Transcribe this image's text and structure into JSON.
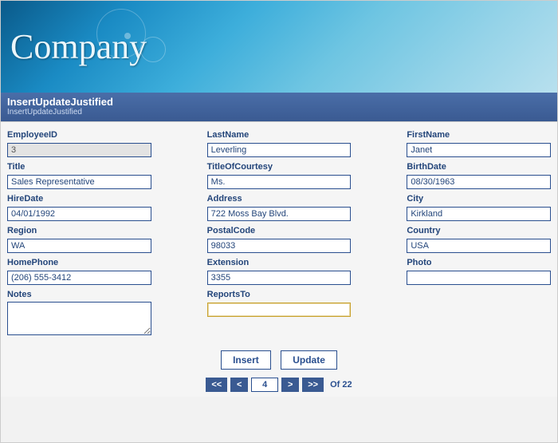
{
  "banner": {
    "title": "Company"
  },
  "subheader": {
    "title": "InsertUpdateJustified",
    "subtitle": "InsertUpdateJustified"
  },
  "fields": {
    "EmployeeID": {
      "label": "EmployeeID",
      "value": "3"
    },
    "LastName": {
      "label": "LastName",
      "value": "Leverling"
    },
    "FirstName": {
      "label": "FirstName",
      "value": "Janet"
    },
    "Title": {
      "label": "Title",
      "value": "Sales Representative"
    },
    "TitleOfCourtesy": {
      "label": "TitleOfCourtesy",
      "value": "Ms."
    },
    "BirthDate": {
      "label": "BirthDate",
      "value": "08/30/1963"
    },
    "HireDate": {
      "label": "HireDate",
      "value": "04/01/1992"
    },
    "Address": {
      "label": "Address",
      "value": "722 Moss Bay Blvd."
    },
    "City": {
      "label": "City",
      "value": "Kirkland"
    },
    "Region": {
      "label": "Region",
      "value": "WA"
    },
    "PostalCode": {
      "label": "PostalCode",
      "value": "98033"
    },
    "Country": {
      "label": "Country",
      "value": "USA"
    },
    "HomePhone": {
      "label": "HomePhone",
      "value": "(206) 555-3412"
    },
    "Extension": {
      "label": "Extension",
      "value": "3355"
    },
    "Photo": {
      "label": "Photo",
      "value": ""
    },
    "Notes": {
      "label": "Notes",
      "value": ""
    },
    "ReportsTo": {
      "label": "ReportsTo",
      "value": ""
    }
  },
  "actions": {
    "insert": "Insert",
    "update": "Update"
  },
  "pager": {
    "first": "<<",
    "prev": "<",
    "next": ">",
    "last": ">>",
    "current": "4",
    "total_text": "Of 22"
  }
}
